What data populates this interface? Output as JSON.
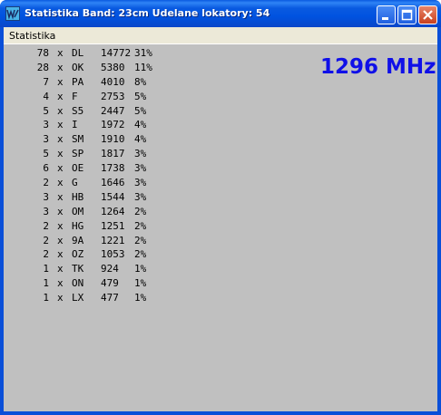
{
  "window": {
    "title": "Statistika  Band: 23cm  Udelane lokatory: 54"
  },
  "menu": {
    "items": [
      "Statistika"
    ]
  },
  "frequency_label": "1296 MHz",
  "rows": [
    {
      "count": "78",
      "x": "x",
      "code": "DL",
      "value": "14772",
      "percent": "31%"
    },
    {
      "count": "28",
      "x": "x",
      "code": "OK",
      "value": "5380",
      "percent": "11%"
    },
    {
      "count": "7",
      "x": "x",
      "code": "PA",
      "value": "4010",
      "percent": "8%"
    },
    {
      "count": "4",
      "x": "x",
      "code": "F",
      "value": "2753",
      "percent": "5%"
    },
    {
      "count": "5",
      "x": "x",
      "code": "S5",
      "value": "2447",
      "percent": "5%"
    },
    {
      "count": "3",
      "x": "x",
      "code": "I",
      "value": "1972",
      "percent": "4%"
    },
    {
      "count": "3",
      "x": "x",
      "code": "SM",
      "value": "1910",
      "percent": "4%"
    },
    {
      "count": "5",
      "x": "x",
      "code": "SP",
      "value": "1817",
      "percent": "3%"
    },
    {
      "count": "6",
      "x": "x",
      "code": "OE",
      "value": "1738",
      "percent": "3%"
    },
    {
      "count": "2",
      "x": "x",
      "code": "G",
      "value": "1646",
      "percent": "3%"
    },
    {
      "count": "3",
      "x": "x",
      "code": "HB",
      "value": "1544",
      "percent": "3%"
    },
    {
      "count": "3",
      "x": "x",
      "code": "OM",
      "value": "1264",
      "percent": "2%"
    },
    {
      "count": "2",
      "x": "x",
      "code": "HG",
      "value": "1251",
      "percent": "2%"
    },
    {
      "count": "2",
      "x": "x",
      "code": "9A",
      "value": "1221",
      "percent": "2%"
    },
    {
      "count": "2",
      "x": "x",
      "code": "OZ",
      "value": "1053",
      "percent": "2%"
    },
    {
      "count": "1",
      "x": "x",
      "code": "TK",
      "value": "924",
      "percent": "1%"
    },
    {
      "count": "1",
      "x": "x",
      "code": "ON",
      "value": "479",
      "percent": "1%"
    },
    {
      "count": "1",
      "x": "x",
      "code": "LX",
      "value": "477",
      "percent": "1%"
    }
  ],
  "colors": {
    "frequency_text": "#1010e8",
    "client_background": "#c0c0c0",
    "titlebar": "#0a5ae0"
  },
  "icons": {
    "app": "app-icon",
    "minimize": "minimize-icon",
    "maximize": "maximize-icon",
    "close": "close-icon"
  }
}
